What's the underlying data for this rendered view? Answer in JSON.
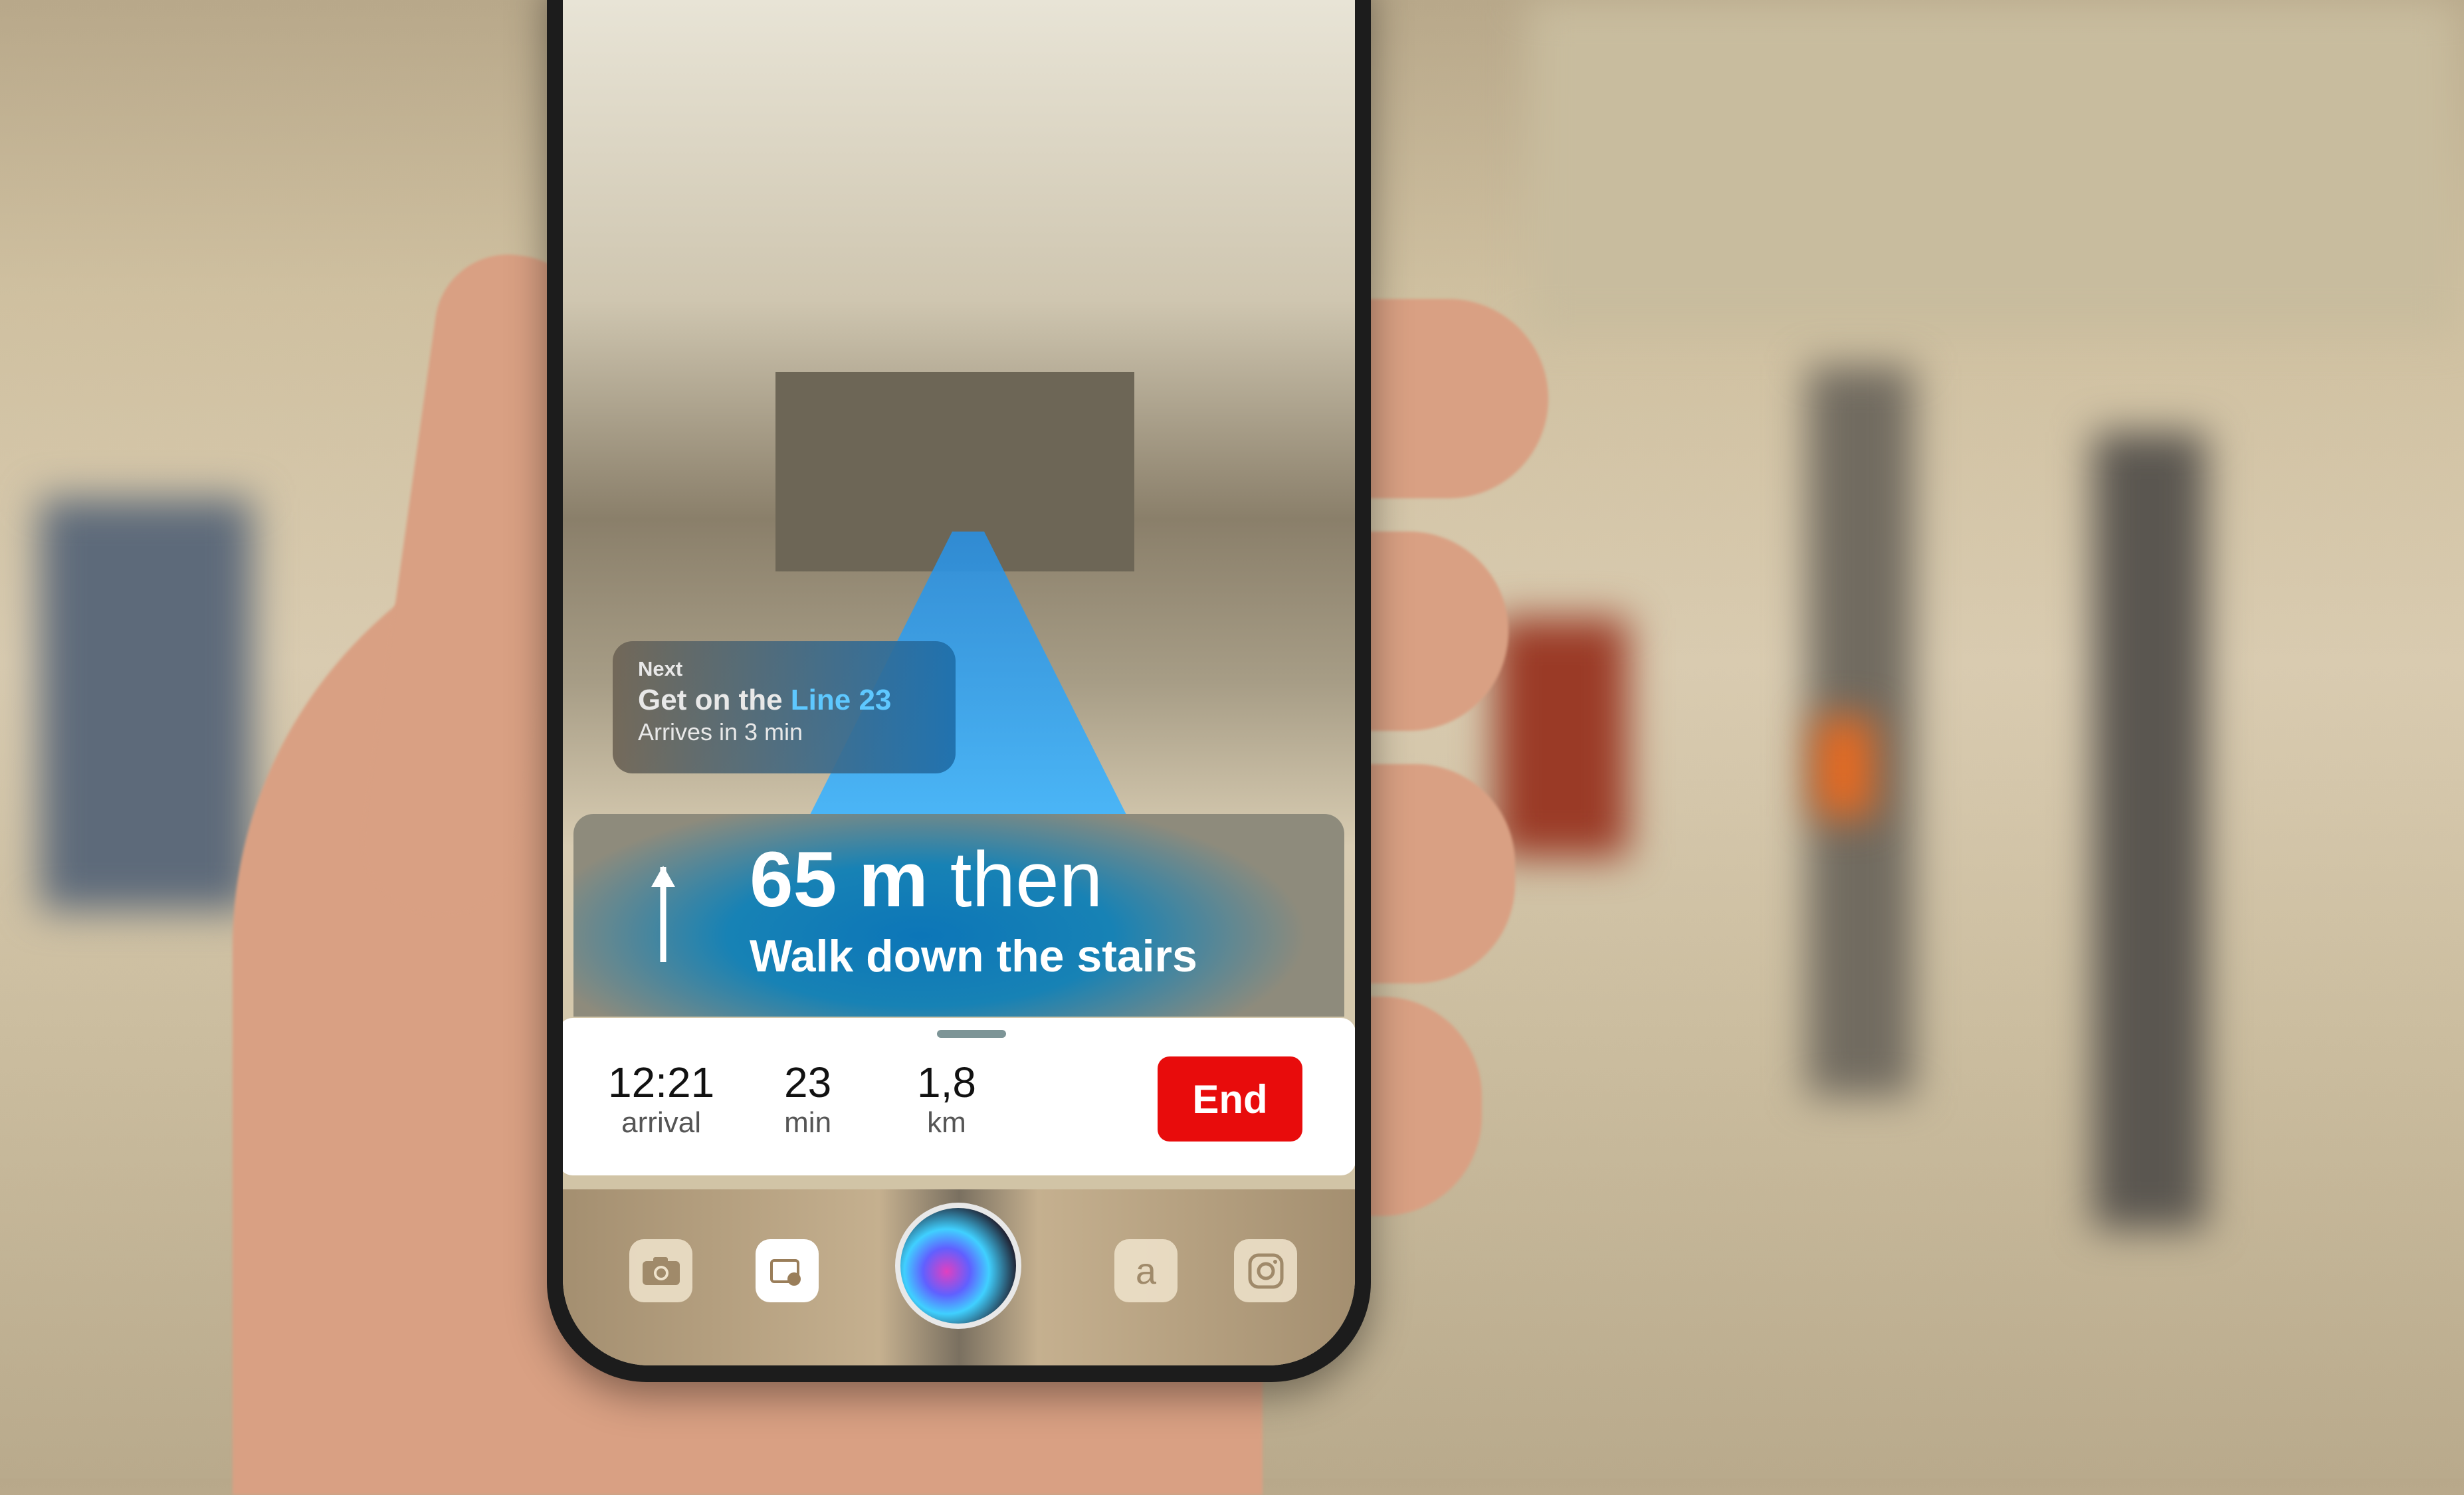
{
  "next_card": {
    "label": "Next",
    "title_prefix": "Get on the ",
    "line": "Line 23",
    "subtitle": "Arrives in 3 min"
  },
  "banner": {
    "distance": "65 m",
    "then": " then",
    "instruction": "Walk down the stairs",
    "direction_icon": "arrow-up-icon"
  },
  "trip": {
    "stats": [
      {
        "value": "12:21",
        "unit": "arrival"
      },
      {
        "value": "23",
        "unit": "min"
      },
      {
        "value": "1,8",
        "unit": "km"
      }
    ],
    "end_label": "End"
  },
  "dock": {
    "apps": [
      "camera-icon",
      "wallet-icon",
      "siri-icon",
      "amazon-icon",
      "instagram-icon"
    ],
    "amazon_glyph": "a"
  },
  "colors": {
    "accent": "#3cb4ff",
    "end": "#e80c0c"
  }
}
